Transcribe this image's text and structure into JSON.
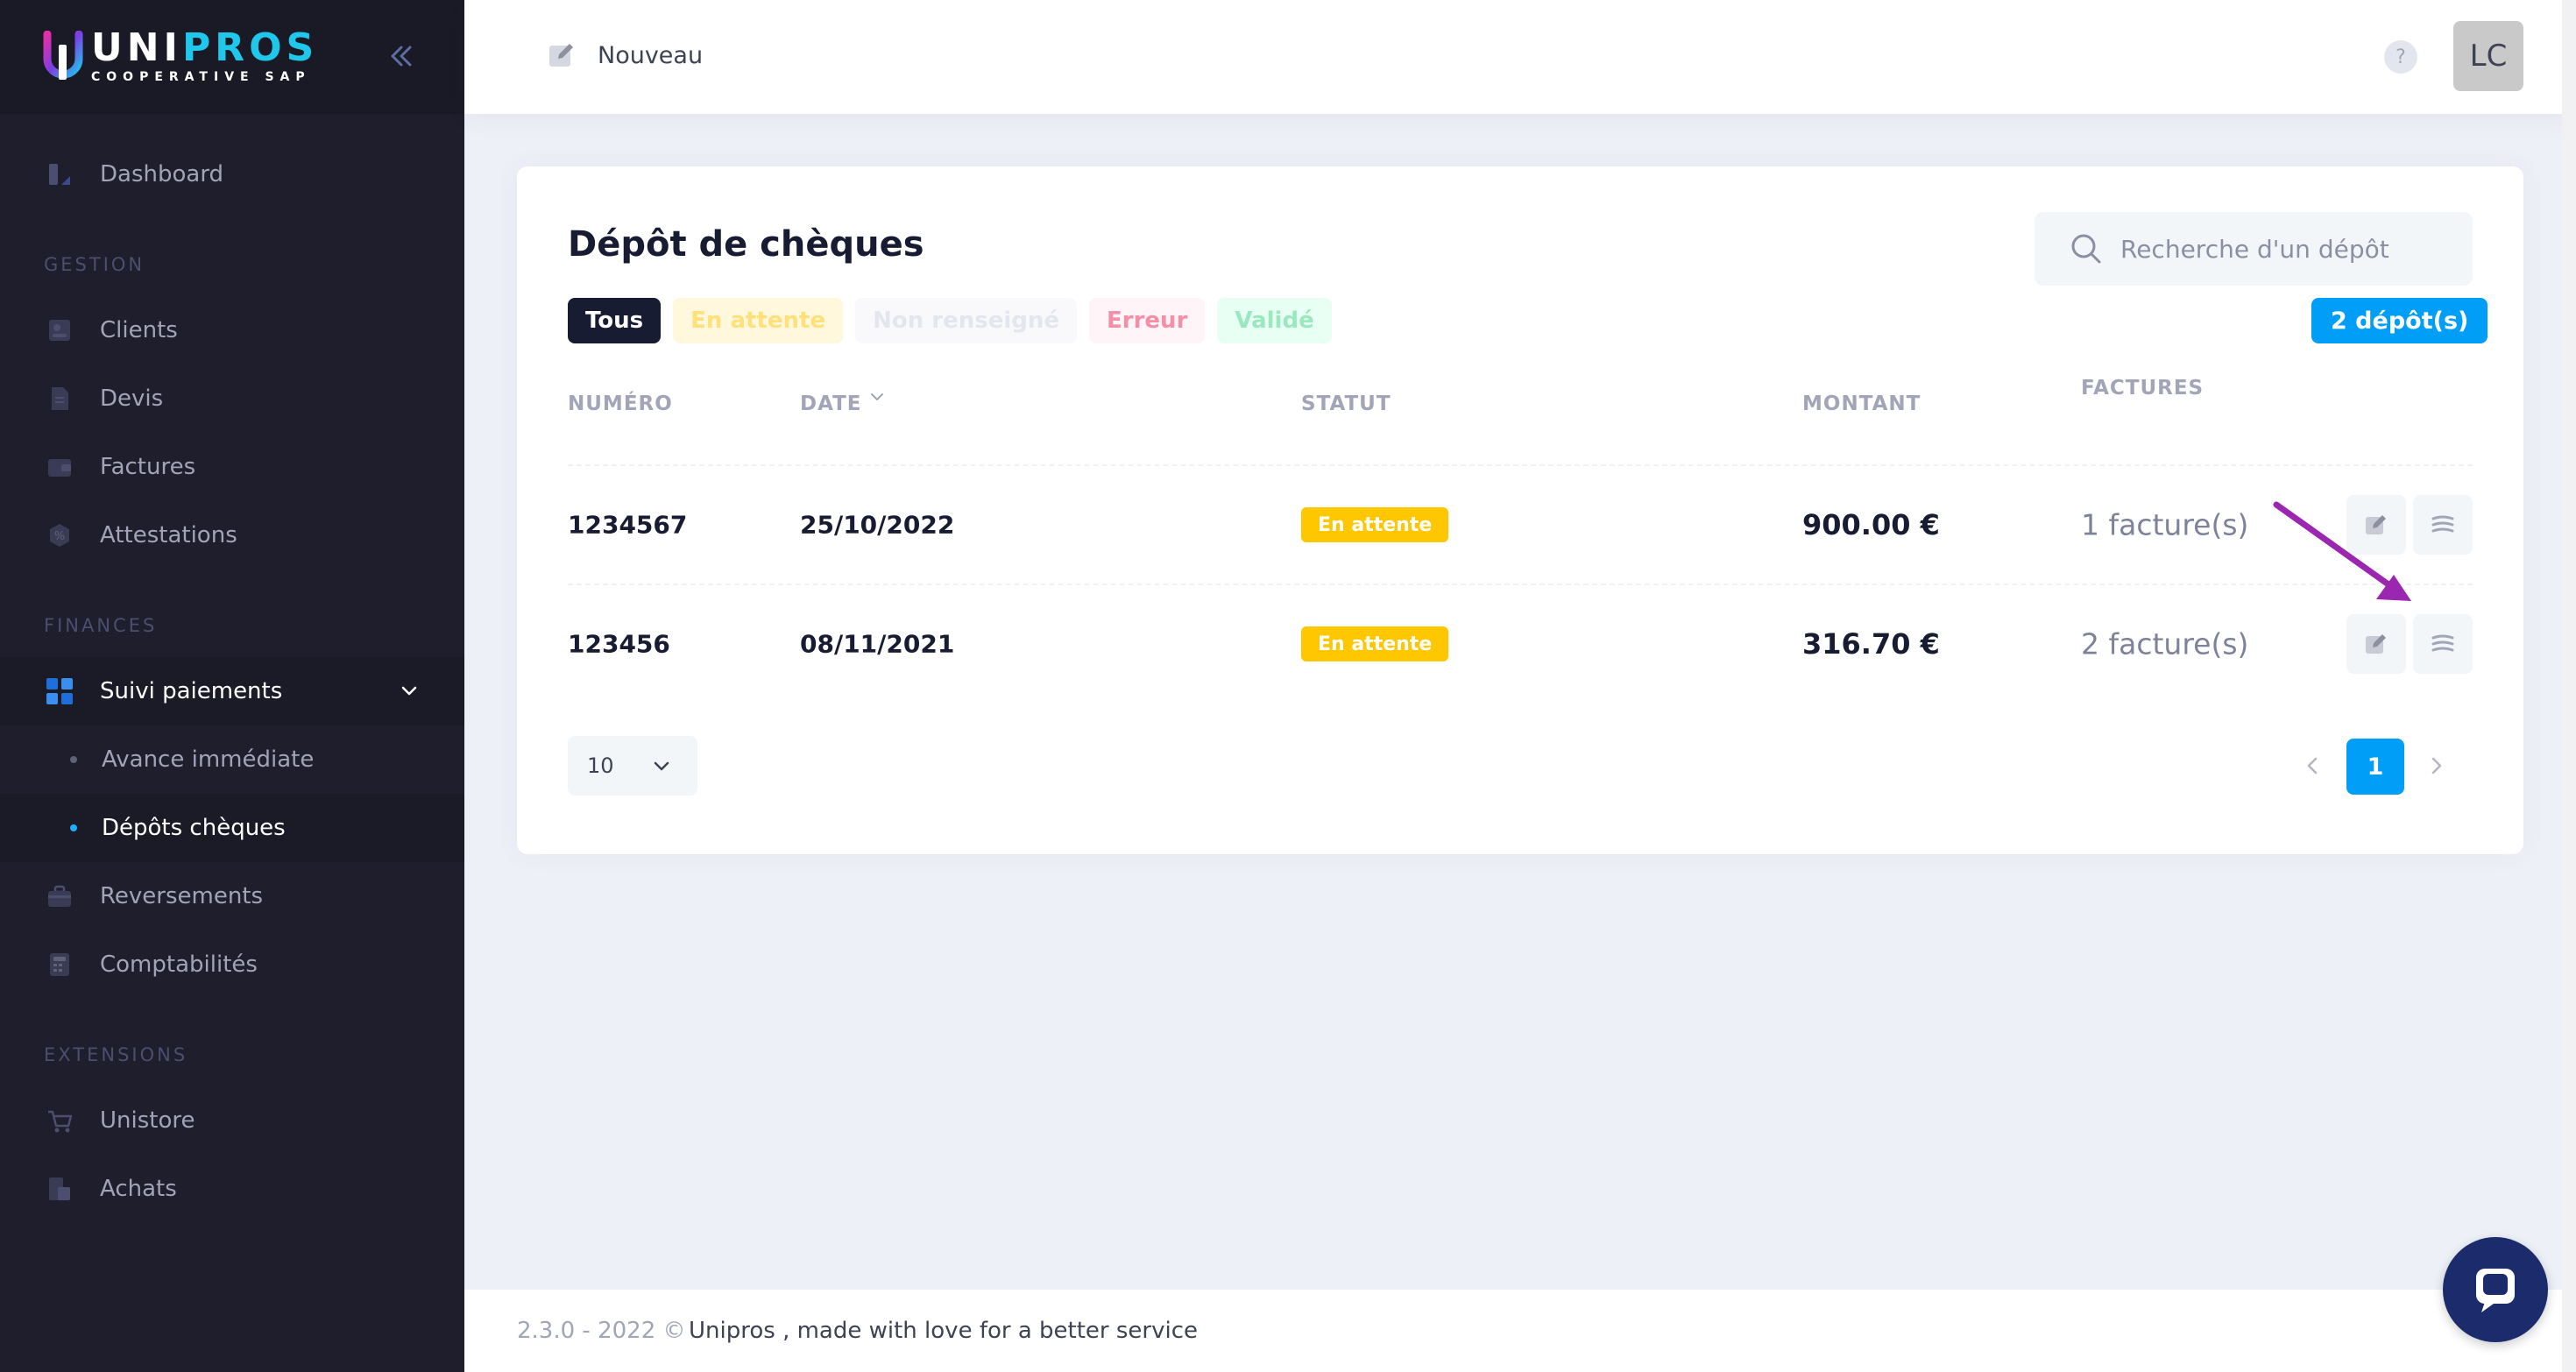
{
  "brand": {
    "title_a": "UNI",
    "title_b": "PROS",
    "subtitle": "COOPERATIVE SAP"
  },
  "sidebar": {
    "dashboard": "Dashboard",
    "gestion_label": "GESTION",
    "clients": "Clients",
    "devis": "Devis",
    "factures": "Factures",
    "attestations": "Attestations",
    "finances_label": "FINANCES",
    "suivi": "Suivi paiements",
    "avance": "Avance immédiate",
    "depots": "Dépôts chèques",
    "reversements": "Reversements",
    "comptabilites": "Comptabilités",
    "extensions_label": "EXTENSIONS",
    "unistore": "Unistore",
    "achats": "Achats"
  },
  "topbar": {
    "new_label": "Nouveau",
    "help": "?",
    "avatar": "LC"
  },
  "card": {
    "title": "Dépôt de chèques",
    "search_placeholder": "Recherche d'un dépôt",
    "filters": {
      "all": "Tous",
      "waiting": "En attente",
      "none": "Non renseigné",
      "error": "Erreur",
      "valid": "Validé"
    },
    "count": "2 dépôt(s)",
    "headers": {
      "num": "NUMÉRO",
      "date": "DATE",
      "status": "STATUT",
      "amount": "MONTANT",
      "invoices": "FACTURES"
    },
    "rows": [
      {
        "num": "1234567",
        "date": "25/10/2022",
        "status": "En attente",
        "amount": "900.00 €",
        "invoices": "1 facture(s)"
      },
      {
        "num": "123456",
        "date": "08/11/2021",
        "status": "En attente",
        "amount": "316.70 €",
        "invoices": "2 facture(s)"
      }
    ],
    "page_size": "10",
    "current_page": "1"
  },
  "footer": {
    "version": "2.3.0 - 2022 ©",
    "text": "Unipros , made with love for a better service"
  },
  "colors": {
    "sidebar_bg": "#1e1e2d",
    "primary": "#009ef7",
    "warning": "#ffc700",
    "annotation": "#9b27b0"
  }
}
